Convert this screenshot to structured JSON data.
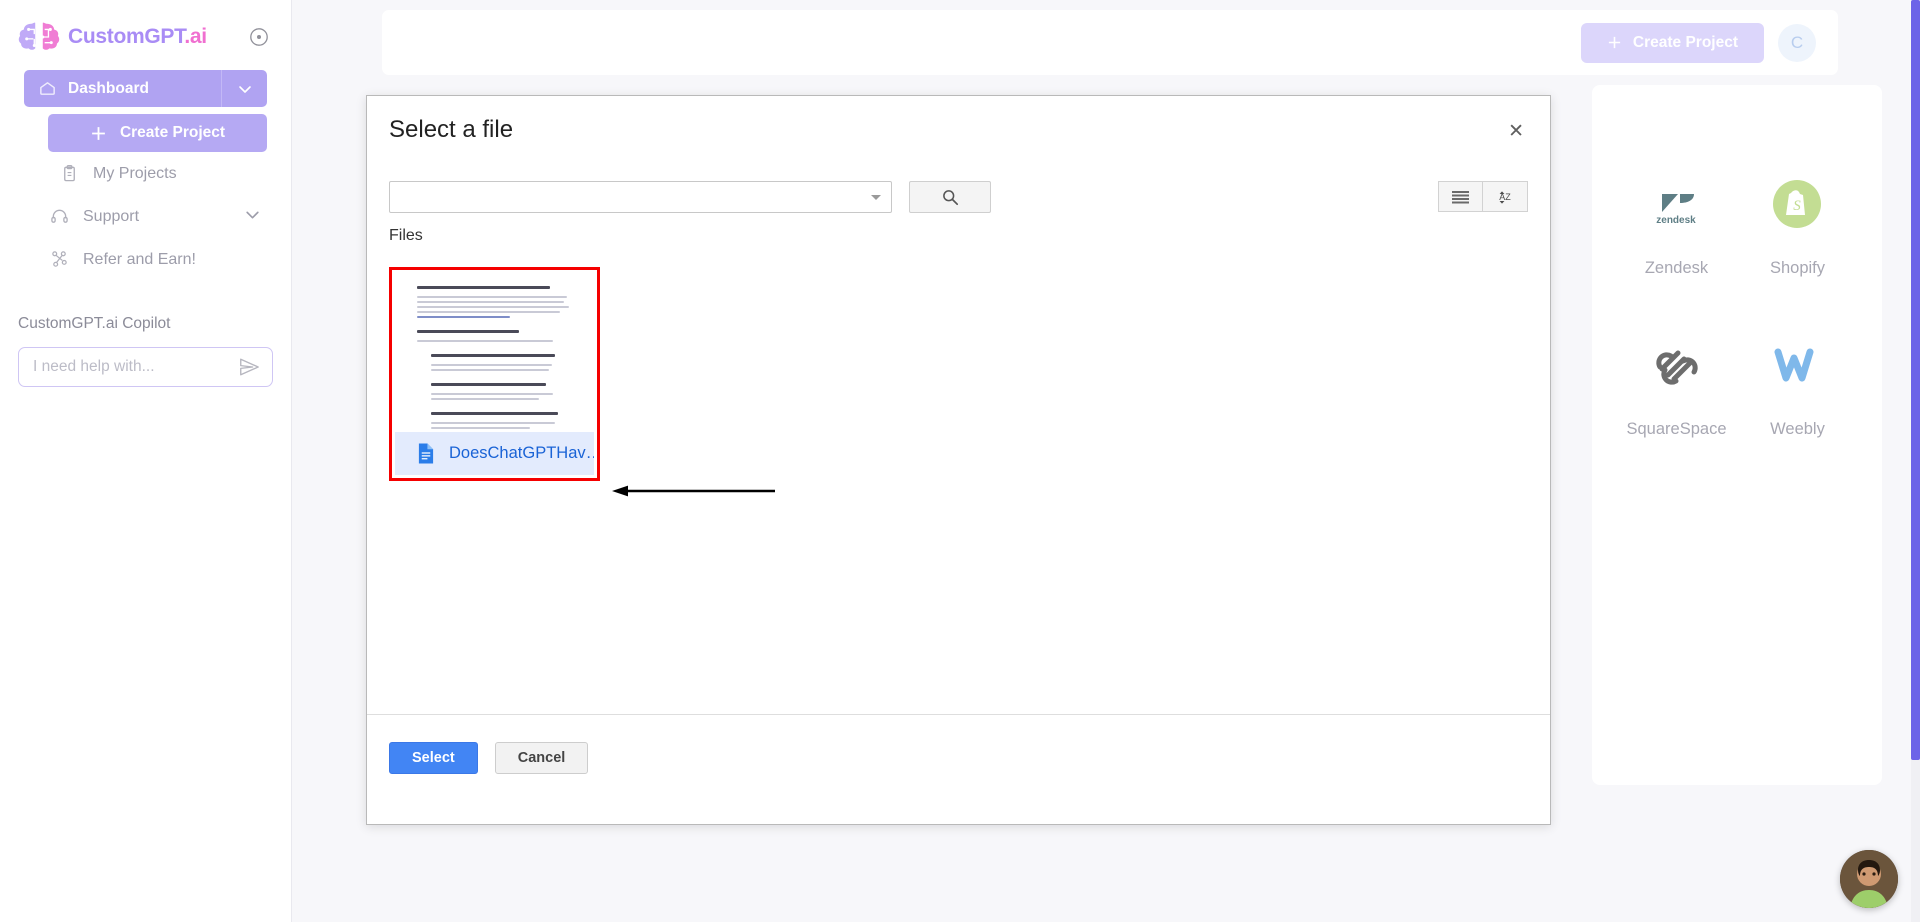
{
  "sidebar": {
    "brand": {
      "part1": "CustomGPT",
      "part2": ".ai",
      "info_icon": "info-circle-icon"
    },
    "dashboard": {
      "label": "Dashboard",
      "icon": "home-icon",
      "caret": "chevron-down-icon"
    },
    "create_project": {
      "label": "Create Project",
      "icon": "plus-icon"
    },
    "items": [
      {
        "label": "My Projects",
        "icon": "clipboard-icon"
      },
      {
        "label": "Support",
        "icon": "headset-icon",
        "caret": "chevron-down-icon"
      },
      {
        "label": "Refer and Earn!",
        "icon": "share-icon"
      }
    ],
    "copilot": {
      "title": "CustomGPT.ai Copilot",
      "placeholder": "I need help with...",
      "send_icon": "send-icon"
    }
  },
  "topbar": {
    "create_project_label": "Create Project",
    "create_project_icon": "plus-icon",
    "avatar_initial": "C"
  },
  "integrations": [
    {
      "name": "Zendesk",
      "icon": "zendesk-logo"
    },
    {
      "name": "Shopify",
      "icon": "shopify-logo"
    },
    {
      "name": "SquareSpace",
      "icon": "squarespace-logo"
    },
    {
      "name": "Weebly",
      "icon": "weebly-logo"
    }
  ],
  "modal": {
    "title": "Select a file",
    "close_icon": "close-icon",
    "filter_value": "",
    "filter_caret_icon": "chevron-down-icon",
    "search_icon": "search-icon",
    "view_buttons": [
      {
        "name": "list-view",
        "icon": "list-view-icon"
      },
      {
        "name": "sort-az",
        "icon": "sort-az-icon"
      }
    ],
    "files_label": "Files",
    "files": [
      {
        "name": "DoesChatGPTHav…",
        "icon": "document-icon",
        "selected": true
      }
    ],
    "select_label": "Select",
    "cancel_label": "Cancel"
  },
  "annotation": {
    "arrow": "left-arrow-annotation"
  },
  "chat_widget": {
    "name": "support-chat-avatar"
  },
  "colors": {
    "brand_purple": "#a98cf5",
    "brand_pink": "#f06fd0",
    "nav_active": "#b0a3f2",
    "primary_button": "#4285f4",
    "highlight_border": "#f50000",
    "file_name": "#1a63d6",
    "scrollbar": "#6c63e8"
  }
}
